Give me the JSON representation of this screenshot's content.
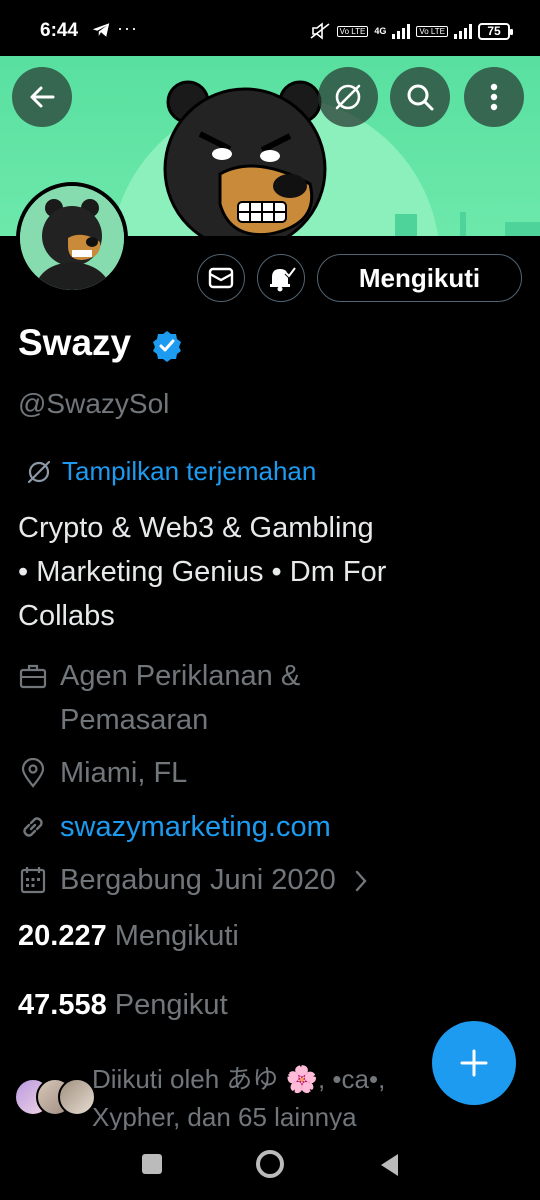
{
  "status_bar": {
    "time": "6:44",
    "more": "···",
    "net_badge_1": "Vo LTE",
    "net_4g": "4G",
    "net_badge_2": "Vo LTE",
    "battery": "75"
  },
  "profile": {
    "name": "Swazy",
    "handle": "@SwazySol",
    "follow_button": "Mengikuti",
    "translate_link": "Tampilkan terjemahan",
    "bio_lines": [
      "Crypto & Web3 & Gambling",
      "• Marketing Genius • Dm For",
      "Collabs"
    ],
    "category_lines": [
      "Agen Periklanan &",
      "Pemasaran"
    ],
    "location": "Miami, FL",
    "website": "swazymarketing.com",
    "joined": "Bergabung Juni 2020",
    "following_count": "20.227",
    "following_label": "Mengikuti",
    "followers_count": "47.558",
    "followers_label": "Pengikut",
    "followed_by_lines": [
      "Diikuti oleh あゆ 🌸, •ca•,",
      "Xypher, dan 65 lainnya"
    ]
  },
  "colors": {
    "accent": "#1d9bf0",
    "banner": "#5fe3a4",
    "muted": "#71767b",
    "background": "#000000"
  },
  "icons": [
    "back-arrow-icon",
    "translate-icon",
    "search-icon",
    "more-vert-icon",
    "mail-icon",
    "bell-icon",
    "verified-badge-icon",
    "briefcase-icon",
    "location-pin-icon",
    "link-icon",
    "calendar-icon",
    "chevron-right-icon",
    "plus-icon"
  ]
}
